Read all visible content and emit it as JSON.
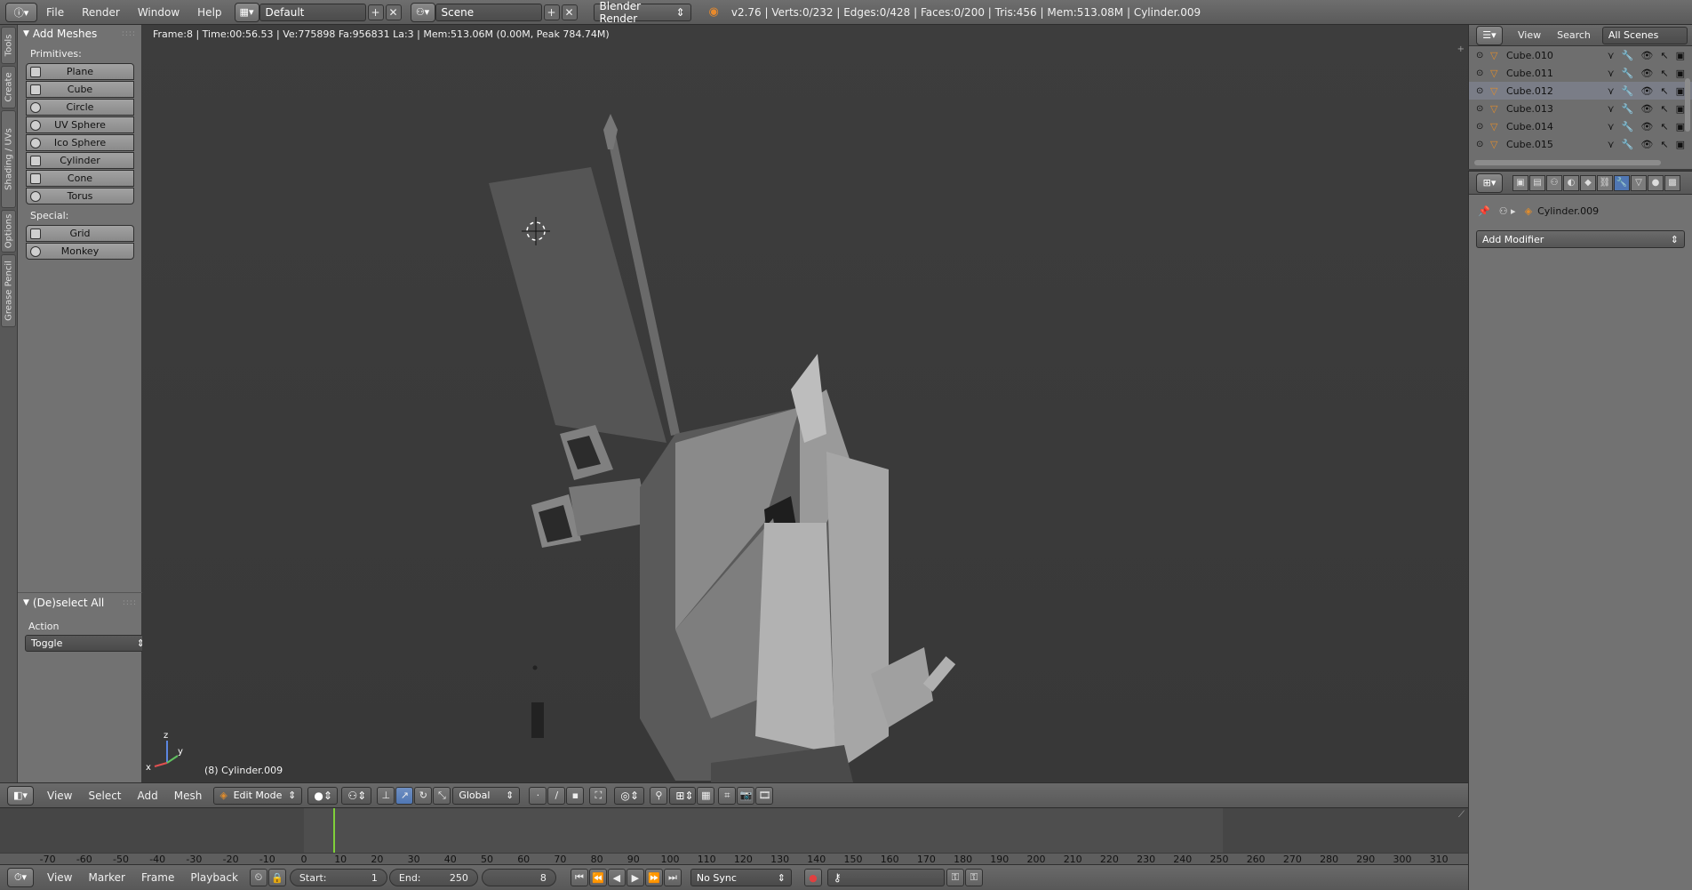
{
  "topbar": {
    "menus": [
      "File",
      "Render",
      "Window",
      "Help"
    ],
    "layout": "Default",
    "scene": "Scene",
    "engine": "Blender Render",
    "stats": "v2.76 | Verts:0/232 | Edges:0/428 | Faces:0/200 | Tris:456 | Mem:513.08M | Cylinder.009"
  },
  "tabs": [
    "Tools",
    "Create",
    "Shading / UVs",
    "Options",
    "Grease Pencil"
  ],
  "toolshelf": {
    "add_meshes_title": "Add Meshes",
    "primitives_label": "Primitives:",
    "primitives": [
      "Plane",
      "Cube",
      "Circle",
      "UV Sphere",
      "Ico Sphere",
      "Cylinder",
      "Cone",
      "Torus"
    ],
    "special_label": "Special:",
    "special": [
      "Grid",
      "Monkey"
    ],
    "deselect_title": "(De)select All",
    "action_label": "Action",
    "action_value": "Toggle"
  },
  "viewport": {
    "info": "Frame:8 | Time:00:56.53 | Ve:775898 Fa:956831 La:3 | Mem:513.06M (0.00M, Peak 784.74M)",
    "object_label": "(8) Cylinder.009"
  },
  "viewport_header": {
    "menus": [
      "View",
      "Select",
      "Add",
      "Mesh"
    ],
    "mode": "Edit Mode",
    "orientation": "Global"
  },
  "timeline": {
    "ticks": [
      "-70",
      "-60",
      "-50",
      "-40",
      "-30",
      "-20",
      "-10",
      "0",
      "10",
      "20",
      "30",
      "40",
      "50",
      "60",
      "70",
      "80",
      "90",
      "100",
      "110",
      "120",
      "130",
      "140",
      "150",
      "160",
      "170",
      "180",
      "190",
      "200",
      "210",
      "220",
      "230",
      "240",
      "250",
      "260",
      "270",
      "280",
      "290",
      "300",
      "310"
    ],
    "current_frame": 8
  },
  "bottombar": {
    "menus": [
      "View",
      "Marker",
      "Frame",
      "Playback"
    ],
    "start_label": "Start:",
    "start_value": "1",
    "end_label": "End:",
    "end_value": "250",
    "current": "8",
    "sync": "No Sync"
  },
  "outliner": {
    "menus": [
      "View",
      "Search"
    ],
    "scope": "All Scenes",
    "items": [
      "Cube.010",
      "Cube.011",
      "Cube.012",
      "Cube.013",
      "Cube.014",
      "Cube.015"
    ],
    "selected_index": 2
  },
  "properties": {
    "object_name": "Cylinder.009",
    "add_modifier": "Add Modifier"
  },
  "colors": {
    "accent_blue": "#5077b4",
    "mesh_orange": "#e08c2c",
    "frame_green": "#7fd03a"
  }
}
